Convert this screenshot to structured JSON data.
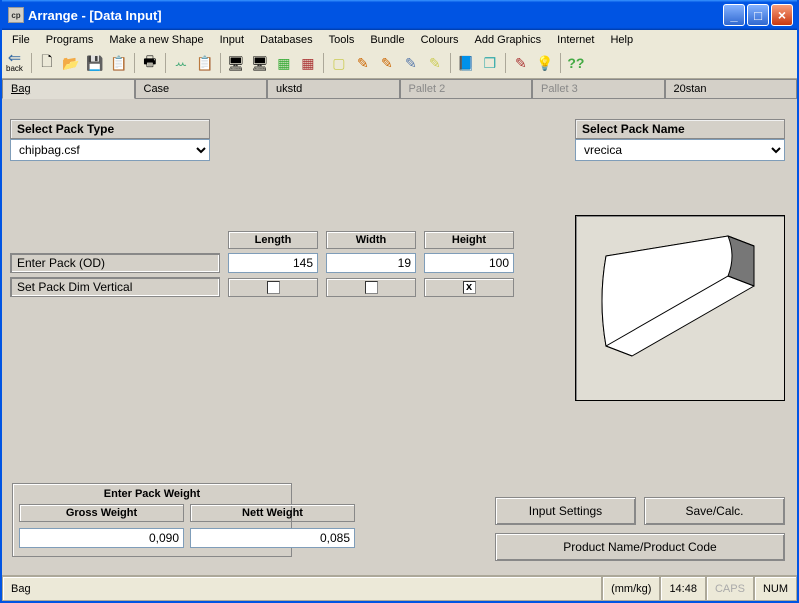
{
  "window": {
    "title": "Arrange - [Data Input]"
  },
  "menu": {
    "items": [
      "File",
      "Programs",
      "Make a new Shape",
      "Input",
      "Databases",
      "Tools",
      "Bundle",
      "Colours",
      "Add Graphics",
      "Internet",
      "Help"
    ]
  },
  "toolbar": {
    "back": "back"
  },
  "tabs": {
    "items": [
      "Bag",
      "Case",
      "ukstd",
      "Pallet 2",
      "Pallet 3",
      "20stan"
    ],
    "active": 0,
    "disabled": [
      3,
      4
    ]
  },
  "form": {
    "select_pack_type_label": "Select Pack Type",
    "select_pack_type_value": "chipbag.csf",
    "select_pack_name_label": "Select Pack Name",
    "select_pack_name_value": "vrecica",
    "length_label": "Length",
    "width_label": "Width",
    "height_label": "Height",
    "enter_pack_od_label": "Enter Pack (OD)",
    "length_value": "145",
    "width_value": "19",
    "height_value": "100",
    "set_vertical_label": "Set Pack Dim Vertical",
    "cb_length": "",
    "cb_width": "",
    "cb_height": "x"
  },
  "weight": {
    "title": "Enter Pack Weight",
    "gross_label": "Gross Weight",
    "nett_label": "Nett Weight",
    "gross_value": "0,090",
    "nett_value": "0,085"
  },
  "buttons": {
    "input_settings": "Input Settings",
    "save_calc": "Save/Calc.",
    "product_name_code": "Product Name/Product Code"
  },
  "status": {
    "left": "Bag",
    "units": "(mm/kg)",
    "time": "14:48",
    "caps": "CAPS",
    "num": "NUM"
  }
}
